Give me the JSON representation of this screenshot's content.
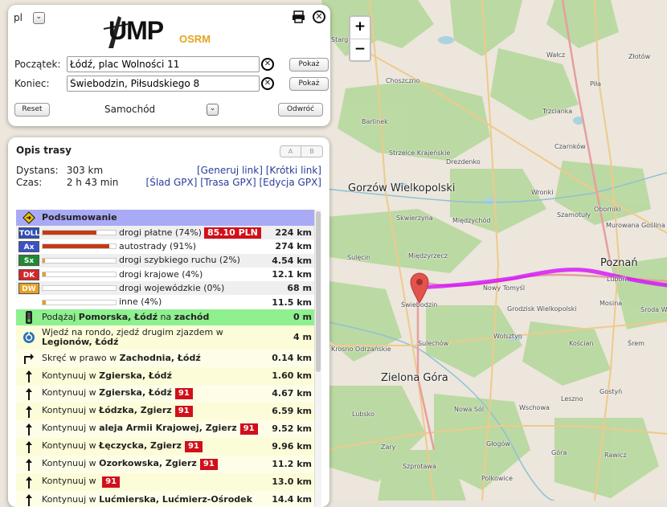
{
  "map": {
    "zoom_in": "+",
    "zoom_out": "−",
    "labels": [
      {
        "text": "Stargard",
        "cls": ""
      },
      {
        "text": "Wałcz",
        "cls": ""
      },
      {
        "text": "Złotów",
        "cls": ""
      },
      {
        "text": "Piła",
        "cls": ""
      },
      {
        "text": "Choszczno",
        "cls": ""
      },
      {
        "text": "Barlinek",
        "cls": ""
      },
      {
        "text": "Trzcianka",
        "cls": ""
      },
      {
        "text": "Strzelce Krajeńskie",
        "cls": ""
      },
      {
        "text": "Drezdenko",
        "cls": ""
      },
      {
        "text": "Czarnków",
        "cls": ""
      },
      {
        "text": "Gorzów Wielkopolski",
        "cls": "big"
      },
      {
        "text": "Skwierzyna",
        "cls": ""
      },
      {
        "text": "Międzychód",
        "cls": ""
      },
      {
        "text": "Wronki",
        "cls": ""
      },
      {
        "text": "Szamotuły",
        "cls": ""
      },
      {
        "text": "Oborniki",
        "cls": ""
      },
      {
        "text": "Murowana Goślina",
        "cls": ""
      },
      {
        "text": "Sulęcin",
        "cls": ""
      },
      {
        "text": "Międzyrzecz",
        "cls": ""
      },
      {
        "text": "Poznań",
        "cls": "big"
      },
      {
        "text": "Luboń",
        "cls": ""
      },
      {
        "text": "Nowy Tomyśl",
        "cls": ""
      },
      {
        "text": "Świebodzin",
        "cls": ""
      },
      {
        "text": "Grodzisk Wielkopolski",
        "cls": ""
      },
      {
        "text": "Mosina",
        "cls": ""
      },
      {
        "text": "Środa W",
        "cls": ""
      },
      {
        "text": "Wolsztyn",
        "cls": ""
      },
      {
        "text": "Sulechów",
        "cls": ""
      },
      {
        "text": "Kościan",
        "cls": ""
      },
      {
        "text": "Śrem",
        "cls": ""
      },
      {
        "text": "Krosno Odrzańskie",
        "cls": ""
      },
      {
        "text": "Zielona Góra",
        "cls": "big"
      },
      {
        "text": "Gostyń",
        "cls": ""
      },
      {
        "text": "Leszno",
        "cls": ""
      },
      {
        "text": "Nowa Sól",
        "cls": ""
      },
      {
        "text": "Wschowa",
        "cls": ""
      },
      {
        "text": "Lubsko",
        "cls": ""
      },
      {
        "text": "Żary",
        "cls": ""
      },
      {
        "text": "Głogów",
        "cls": ""
      },
      {
        "text": "Góra",
        "cls": ""
      },
      {
        "text": "Rawicz",
        "cls": ""
      },
      {
        "text": "Szprotawa",
        "cls": ""
      },
      {
        "text": "Polkowice",
        "cls": ""
      }
    ]
  },
  "top": {
    "lang": "pl",
    "logo_text": "UMP",
    "logo_osrm": "OSRM",
    "from_label": "Początek:",
    "from_value": "Łódź, plac Wolności 11",
    "to_label": "Koniec:",
    "to_value": "Świebodzin, Piłsudskiego 8",
    "show_label": "Pokaż",
    "reset_label": "Reset",
    "vehicle": "Samochód",
    "reverse_label": "Odwróć"
  },
  "route": {
    "title": "Opis trasy",
    "a": "A",
    "b": "B",
    "distance_label": "Dystans:",
    "distance_value": "303 km",
    "time_label": "Czas:",
    "time_value": "2 h 43 min",
    "link_generate": "[Generuj link]",
    "link_short": "[Krótki link]",
    "link_trace": "[Ślad GPX]",
    "link_route": "[Trasa GPX]",
    "link_edit": "[Edycja GPX]",
    "summary_title": "Podsumowanie",
    "summary": [
      {
        "badge": "TOLL",
        "color": "#2f4fb5",
        "label": "drogi płatne (74%)",
        "level": 74,
        "price": "85.10 PLN",
        "dist": "224 km"
      },
      {
        "badge": "Ax",
        "color": "#3a52c6",
        "label": "autostrady (91%)",
        "level": 91,
        "price": "",
        "dist": "274 km"
      },
      {
        "badge": "Sx",
        "color": "#1e8a33",
        "label": "drogi szybkiego ruchu (2%)",
        "level": 2,
        "price": "",
        "dist": "4.54 km"
      },
      {
        "badge": "DK",
        "color": "#d5242a",
        "label": "drogi krajowe (4%)",
        "level": 4,
        "price": "",
        "dist": "12.1 km"
      },
      {
        "badge": "DW",
        "color": "#e7a21f",
        "label": "drogi wojewódzkie (0%)",
        "level": 0,
        "price": "",
        "dist": "68 m"
      },
      {
        "badge": "",
        "color": "",
        "label": "inne (4%)",
        "level": 4,
        "price": "",
        "dist": "11.5 km"
      }
    ],
    "steps": [
      {
        "kind": "start",
        "icon": "traffic-light-icon",
        "pre": "Podążaj ",
        "bold": "Pomorska, Łódź",
        "mid": " na ",
        "bold2": "zachód",
        "road": "",
        "dist": "0 m"
      },
      {
        "kind": "roundabout",
        "icon": "roundabout-icon",
        "pre": "Wjedź na rondo, zjedź drugim zjazdem w ",
        "bold": "Legionów, Łódź",
        "mid": "",
        "bold2": "",
        "road": "",
        "dist": "4 m"
      },
      {
        "kind": "right",
        "icon": "turn-right-icon",
        "pre": "Skręć w prawo w ",
        "bold": "Zachodnia, Łódź",
        "mid": "",
        "bold2": "",
        "road": "",
        "dist": "0.14 km"
      },
      {
        "kind": "straight",
        "icon": "arrow-up-icon",
        "pre": "Kontynuuj w ",
        "bold": "Zgierska, Łódź",
        "mid": "",
        "bold2": "",
        "road": "",
        "dist": "1.60 km"
      },
      {
        "kind": "straight",
        "icon": "arrow-up-icon",
        "pre": "Kontynuuj w ",
        "bold": "Zgierska, Łódź",
        "mid": "",
        "bold2": "",
        "road": "91",
        "dist": "4.67 km"
      },
      {
        "kind": "straight",
        "icon": "arrow-up-icon",
        "pre": "Kontynuuj w ",
        "bold": "Łódzka, Zgierz",
        "mid": "",
        "bold2": "",
        "road": "91",
        "dist": "6.59 km"
      },
      {
        "kind": "straight",
        "icon": "arrow-up-icon",
        "pre": "Kontynuuj w ",
        "bold": "aleja Armii Krajowej, Zgierz",
        "mid": "",
        "bold2": "",
        "road": "91",
        "dist": "9.52 km"
      },
      {
        "kind": "straight",
        "icon": "arrow-up-icon",
        "pre": "Kontynuuj w ",
        "bold": "Łęczycka, Zgierz",
        "mid": "",
        "bold2": "",
        "road": "91",
        "dist": "9.96 km"
      },
      {
        "kind": "straight",
        "icon": "arrow-up-icon",
        "pre": "Kontynuuj w ",
        "bold": "Ozorkowska, Zgierz",
        "mid": "",
        "bold2": "",
        "road": "91",
        "dist": "11.2 km"
      },
      {
        "kind": "straight",
        "icon": "arrow-up-icon",
        "pre": "Kontynuuj w ",
        "bold": "",
        "mid": "",
        "bold2": "",
        "road": "91",
        "dist": "13.0 km"
      },
      {
        "kind": "straight",
        "icon": "arrow-up-icon",
        "pre": "Kontynuuj w ",
        "bold": "Lućmierska, Lućmierz-Ośrodek",
        "mid": "",
        "bold2": "",
        "road": "",
        "dist": "14.4 km"
      }
    ]
  }
}
